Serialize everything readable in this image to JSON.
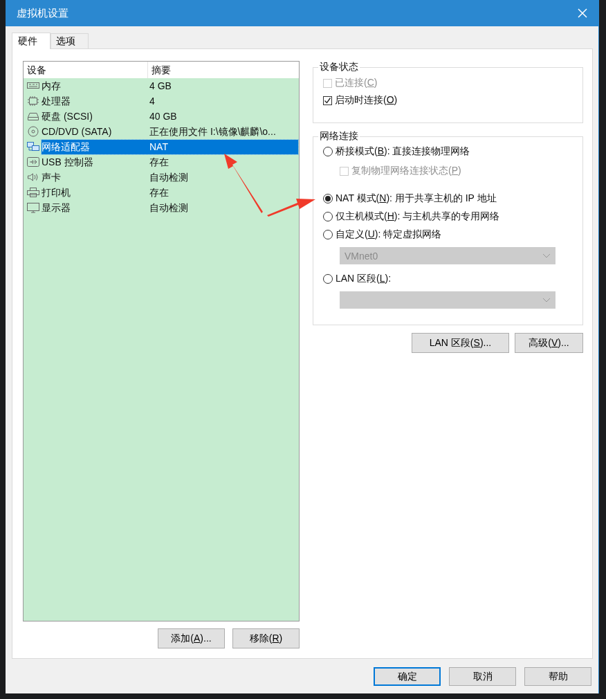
{
  "window": {
    "title": "虚拟机设置"
  },
  "tabs": [
    {
      "label": "硬件",
      "selected": true
    },
    {
      "label": "选项",
      "selected": false
    }
  ],
  "device_table": {
    "columns": [
      "设备",
      "摘要"
    ],
    "rows": [
      {
        "kind": "memory",
        "device": "内存",
        "summary": "4 GB",
        "selected": false
      },
      {
        "kind": "cpu",
        "device": "处理器",
        "summary": "4",
        "selected": false
      },
      {
        "kind": "disk",
        "device": "硬盘 (SCSI)",
        "summary": "40 GB",
        "selected": false
      },
      {
        "kind": "cdrom",
        "device": "CD/DVD (SATA)",
        "summary": "正在使用文件 I:\\镜像\\麒麟\\o...",
        "selected": false
      },
      {
        "kind": "network",
        "device": "网络适配器",
        "summary": "NAT",
        "selected": true
      },
      {
        "kind": "usb",
        "device": "USB 控制器",
        "summary": "存在",
        "selected": false
      },
      {
        "kind": "sound",
        "device": "声卡",
        "summary": "自动检测",
        "selected": false
      },
      {
        "kind": "printer",
        "device": "打印机",
        "summary": "存在",
        "selected": false
      },
      {
        "kind": "display",
        "device": "显示器",
        "summary": "自动检测",
        "selected": false
      }
    ]
  },
  "device_buttons": [
    {
      "pre": "添加(",
      "key": "A",
      "post": ")..."
    },
    {
      "pre": "移除(",
      "key": "R",
      "post": ")"
    }
  ],
  "device_status": {
    "title": "设备状态",
    "options": [
      {
        "pre": "已连接(",
        "key": "C",
        "post": ")",
        "checked": false,
        "disabled": true
      },
      {
        "pre": "启动时连接(",
        "key": "O",
        "post": ")",
        "checked": true,
        "disabled": false
      }
    ]
  },
  "network_connection": {
    "title": "网络连接",
    "items": [
      {
        "kind": "radio",
        "pre": "桥接模式(",
        "key": "B",
        "post": "): 直接连接物理网络",
        "selected": false
      },
      {
        "kind": "checkbox",
        "pre": "复制物理网络连接状态(",
        "key": "P",
        "post": ")",
        "checked": false,
        "disabled": true
      },
      {
        "kind": "radio",
        "pre": "NAT 模式(",
        "key": "N",
        "post": "): 用于共享主机的 IP 地址",
        "selected": true
      },
      {
        "kind": "radio",
        "pre": "仅主机模式(",
        "key": "H",
        "post": "): 与主机共享的专用网络",
        "selected": false
      },
      {
        "kind": "radio",
        "pre": "自定义(",
        "key": "U",
        "post": "): 特定虚拟网络",
        "selected": false
      },
      {
        "kind": "dropdown",
        "value": "VMnet0",
        "disabled": true
      },
      {
        "kind": "radio",
        "pre": "LAN 区段(",
        "key": "L",
        "post": "):",
        "selected": false
      },
      {
        "kind": "dropdown",
        "disabled": true
      }
    ]
  },
  "network_buttons": [
    {
      "pre": "LAN 区段(",
      "key": "S",
      "post": ")..."
    },
    {
      "pre": "高级(",
      "key": "V",
      "post": ")..."
    }
  ],
  "dialog_buttons": [
    {
      "label": "确定",
      "default": true
    },
    {
      "label": "取消",
      "default": false
    },
    {
      "label": "帮助",
      "default": false
    }
  ]
}
